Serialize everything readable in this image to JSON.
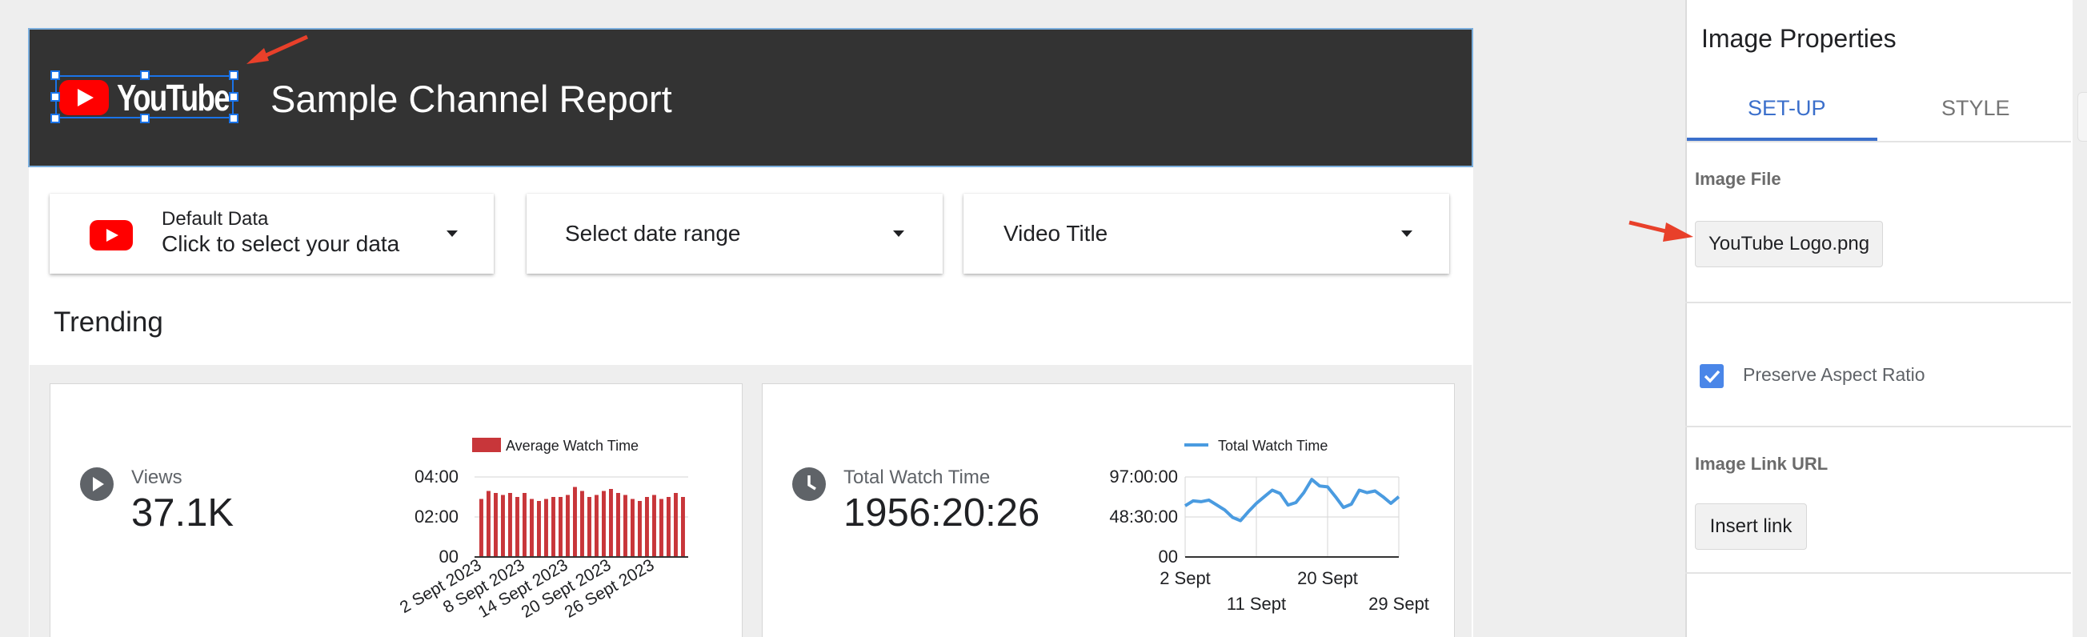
{
  "report": {
    "title": "Sample Channel Report",
    "logo_text": "YouTube"
  },
  "controls": {
    "data_source": {
      "label_small": "Default Data",
      "label_main": "Click to select your data"
    },
    "date_range": {
      "label": "Select date range"
    },
    "video_title": {
      "label": "Video Title"
    }
  },
  "section": {
    "trending_label": "Trending"
  },
  "cards": {
    "views": {
      "label": "Views",
      "value": "37.1K"
    },
    "watch_time": {
      "label": "Total Watch Time",
      "value": "1956:20:26"
    }
  },
  "chart_data": [
    {
      "type": "bar",
      "legend": [
        "Average Watch Time"
      ],
      "series": [
        {
          "name": "Average Watch Time",
          "color": "#c8363a",
          "values": [
            2.9,
            3.3,
            3.2,
            3.1,
            3.2,
            3.0,
            3.2,
            2.9,
            2.8,
            2.9,
            3.0,
            3.0,
            3.1,
            3.5,
            3.3,
            3.0,
            3.1,
            3.3,
            3.4,
            3.2,
            3.1,
            2.9,
            2.8,
            3.0,
            3.1,
            2.9,
            3.0,
            3.2,
            3.0
          ]
        }
      ],
      "ytick_labels": [
        "04:00",
        "02:00",
        "00"
      ],
      "ylim": [
        0,
        4
      ],
      "xtick_labels": [
        "2 Sept 2023",
        "8 Sept 2023",
        "14 Sept 2023",
        "20 Sept 2023",
        "26 Sept 2023"
      ]
    },
    {
      "type": "line",
      "legend": [
        "Total Watch Time"
      ],
      "series": [
        {
          "name": "Total Watch Time",
          "color": "#4a9be0",
          "x": [
            2,
            3,
            4,
            5,
            6,
            7,
            8,
            9,
            10,
            11,
            12,
            13,
            14,
            15,
            16,
            17,
            18,
            19,
            20,
            21,
            22,
            23,
            24,
            25,
            26,
            27,
            28,
            29
          ],
          "values": [
            62,
            68,
            67,
            69,
            63,
            57,
            48,
            44,
            55,
            65,
            73,
            81,
            77,
            63,
            66,
            78,
            94,
            86,
            85,
            73,
            60,
            64,
            81,
            78,
            80,
            73,
            65,
            73
          ]
        }
      ],
      "ytick_labels": [
        "97:00:00",
        "48:30:00",
        "00"
      ],
      "ylim": [
        0,
        97
      ],
      "xtick_labels": [
        "2 Sept",
        "11 Sept",
        "20 Sept",
        "29 Sept"
      ],
      "xtick_values": [
        2,
        11,
        20,
        29
      ],
      "xlim": [
        2,
        29
      ],
      "grid": true
    }
  ],
  "panel": {
    "title": "Image Properties",
    "tabs": [
      "SET-UP",
      "STYLE"
    ],
    "active_tab": "SET-UP",
    "accent_color": "#3b6fcb",
    "image_file_label": "Image File",
    "image_file_value": "YouTube Logo.png",
    "preserve_aspect_label": "Preserve Aspect Ratio",
    "preserve_aspect_checked": true,
    "link_url_label": "Image Link URL",
    "insert_link_label": "Insert link"
  }
}
